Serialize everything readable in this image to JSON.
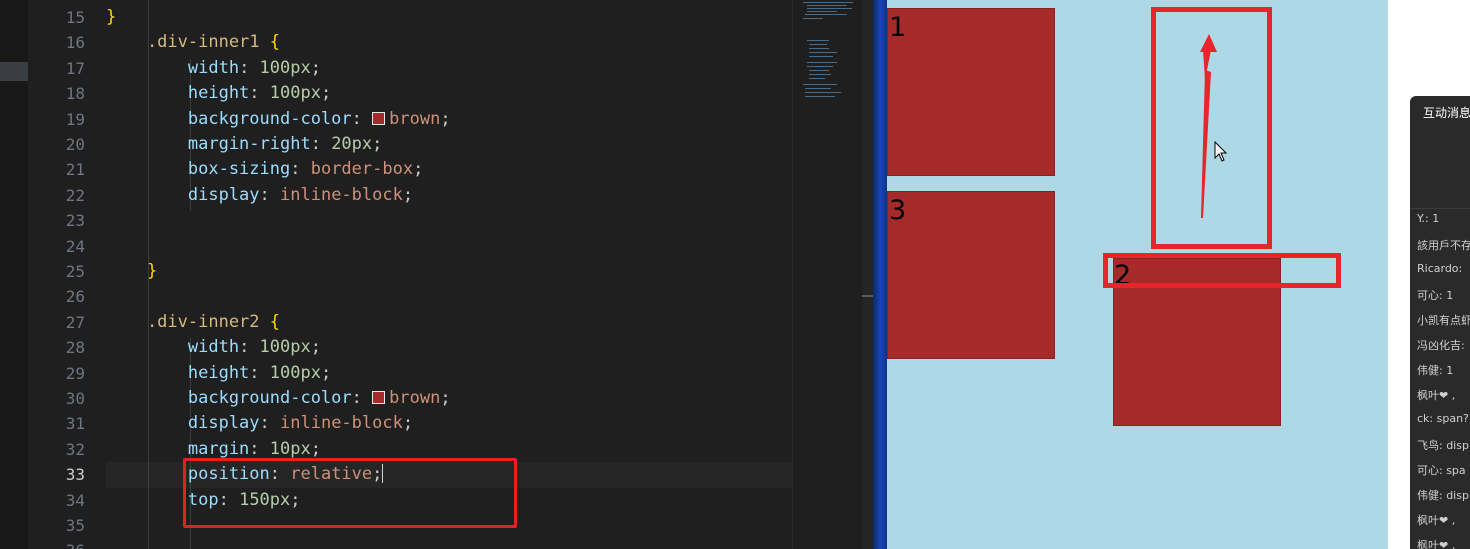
{
  "editor": {
    "lines": [
      {
        "n": "15",
        "tokens": [
          {
            "t": "}",
            "c": "brace"
          }
        ]
      },
      {
        "n": "16",
        "tokens": [
          {
            "t": "    .div-inner1 ",
            "c": "sel"
          },
          {
            "t": "{",
            "c": "brace"
          }
        ]
      },
      {
        "n": "17",
        "tokens": [
          {
            "t": "        width",
            "c": "prop"
          },
          {
            "t": ": ",
            "c": "pun"
          },
          {
            "t": "100px",
            "c": "num"
          },
          {
            "t": ";",
            "c": "pun"
          }
        ]
      },
      {
        "n": "18",
        "tokens": [
          {
            "t": "        height",
            "c": "prop"
          },
          {
            "t": ": ",
            "c": "pun"
          },
          {
            "t": "100px",
            "c": "num"
          },
          {
            "t": ";",
            "c": "pun"
          }
        ]
      },
      {
        "n": "19",
        "tokens": [
          {
            "t": "        background-color",
            "c": "prop"
          },
          {
            "t": ": ",
            "c": "pun"
          },
          {
            "t": "",
            "c": "swatch"
          },
          {
            "t": "brown",
            "c": "val"
          },
          {
            "t": ";",
            "c": "pun"
          }
        ]
      },
      {
        "n": "20",
        "tokens": [
          {
            "t": "        margin-right",
            "c": "prop"
          },
          {
            "t": ": ",
            "c": "pun"
          },
          {
            "t": "20px",
            "c": "num"
          },
          {
            "t": ";",
            "c": "pun"
          }
        ]
      },
      {
        "n": "21",
        "tokens": [
          {
            "t": "        box-sizing",
            "c": "prop"
          },
          {
            "t": ": ",
            "c": "pun"
          },
          {
            "t": "border-box",
            "c": "val"
          },
          {
            "t": ";",
            "c": "pun"
          }
        ]
      },
      {
        "n": "22",
        "tokens": [
          {
            "t": "        display",
            "c": "prop"
          },
          {
            "t": ": ",
            "c": "pun"
          },
          {
            "t": "inline-block",
            "c": "val"
          },
          {
            "t": ";",
            "c": "pun"
          }
        ]
      },
      {
        "n": "23",
        "tokens": []
      },
      {
        "n": "24",
        "tokens": []
      },
      {
        "n": "25",
        "tokens": [
          {
            "t": "    }",
            "c": "brace"
          }
        ]
      },
      {
        "n": "26",
        "tokens": []
      },
      {
        "n": "27",
        "tokens": [
          {
            "t": "    .div-inner2 ",
            "c": "sel"
          },
          {
            "t": "{",
            "c": "brace"
          }
        ]
      },
      {
        "n": "28",
        "tokens": [
          {
            "t": "        width",
            "c": "prop"
          },
          {
            "t": ": ",
            "c": "pun"
          },
          {
            "t": "100px",
            "c": "num"
          },
          {
            "t": ";",
            "c": "pun"
          }
        ]
      },
      {
        "n": "29",
        "tokens": [
          {
            "t": "        height",
            "c": "prop"
          },
          {
            "t": ": ",
            "c": "pun"
          },
          {
            "t": "100px",
            "c": "num"
          },
          {
            "t": ";",
            "c": "pun"
          }
        ]
      },
      {
        "n": "30",
        "tokens": [
          {
            "t": "        background-color",
            "c": "prop"
          },
          {
            "t": ": ",
            "c": "pun"
          },
          {
            "t": "",
            "c": "swatch"
          },
          {
            "t": "brown",
            "c": "val"
          },
          {
            "t": ";",
            "c": "pun"
          }
        ]
      },
      {
        "n": "31",
        "tokens": [
          {
            "t": "        display",
            "c": "prop"
          },
          {
            "t": ": ",
            "c": "pun"
          },
          {
            "t": "inline-block",
            "c": "val"
          },
          {
            "t": ";",
            "c": "pun"
          }
        ]
      },
      {
        "n": "32",
        "tokens": [
          {
            "t": "        margin",
            "c": "prop"
          },
          {
            "t": ": ",
            "c": "pun"
          },
          {
            "t": "10px",
            "c": "num"
          },
          {
            "t": ";",
            "c": "pun"
          }
        ]
      },
      {
        "n": "33",
        "tokens": [
          {
            "t": "        position",
            "c": "prop"
          },
          {
            "t": ": ",
            "c": "pun"
          },
          {
            "t": "relative",
            "c": "val"
          },
          {
            "t": ";",
            "c": "pun"
          },
          {
            "t": "",
            "c": "caret"
          }
        ]
      },
      {
        "n": "34",
        "tokens": [
          {
            "t": "        top",
            "c": "prop"
          },
          {
            "t": ": ",
            "c": "pun"
          },
          {
            "t": "150px",
            "c": "num"
          },
          {
            "t": ";",
            "c": "pun"
          }
        ]
      },
      {
        "n": "35",
        "tokens": []
      },
      {
        "n": "36",
        "tokens": []
      }
    ],
    "active_line": "33",
    "swatch_color": "#a52a2a"
  },
  "preview": {
    "background": "#add8e6",
    "box_color": "#a52a2a",
    "boxes": [
      {
        "label": "1"
      },
      {
        "label": "3"
      },
      {
        "label": "2"
      }
    ],
    "annotation_color": "#e8242c"
  },
  "chat": {
    "title": "互动消息",
    "messages": [
      "Y.: 1",
      "該用戶不存",
      "Ricardo: ",
      "可心: 1",
      "小凯有点虾",
      "冯凶化吉:",
      "伟健: 1",
      "枫叶❤ ,",
      "ck: span?",
      "飞鸟: disp",
      "可心: spa",
      "伟健: disp",
      "枫叶❤ ,",
      "枫叶❤ ,"
    ]
  }
}
